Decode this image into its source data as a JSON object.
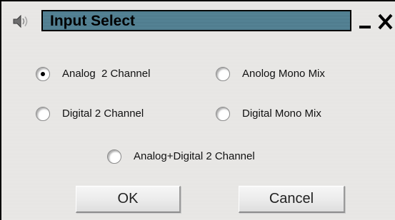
{
  "window": {
    "title": "Input Select"
  },
  "options": [
    {
      "label": "Analog  2 Channel",
      "selected": true
    },
    {
      "label": "Anolog Mono Mix",
      "selected": false
    },
    {
      "label": "Digital 2 Channel",
      "selected": false
    },
    {
      "label": "Digital Mono Mix",
      "selected": false
    },
    {
      "label": "Analog+Digital 2 Channel",
      "selected": false
    }
  ],
  "buttons": {
    "ok_label": "OK",
    "cancel_label": "Cancel"
  },
  "icons": {
    "app": "speaker-icon",
    "minimize": "minimize-icon",
    "close": "close-icon"
  },
  "colors": {
    "title_bar": "#4f7d8f",
    "background": "#e8e8e6"
  }
}
